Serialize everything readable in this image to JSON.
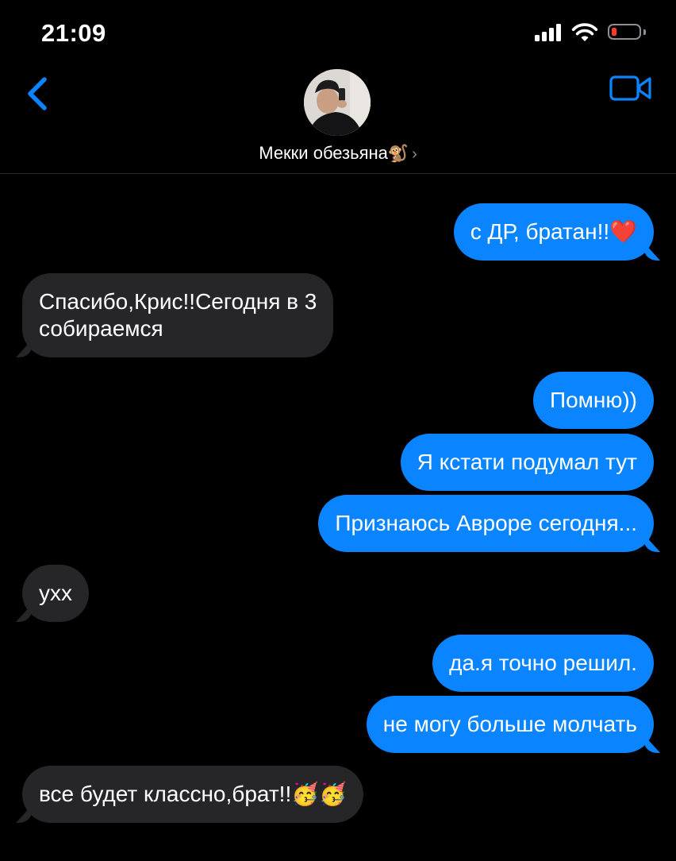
{
  "status_bar": {
    "time": "21:09",
    "battery_color": "#ff3b30"
  },
  "header": {
    "contact_name": "Мекки обезьяна",
    "contact_emoji": "🐒",
    "chevron": "›",
    "icons": [
      "back-chevron-icon",
      "contact-avatar",
      "video-camera-icon"
    ],
    "accent_color": "#0a84ff"
  },
  "messages": [
    {
      "from": "me",
      "text": "с ДР, братан!!",
      "emoji": "❤️"
    },
    {
      "from": "contact",
      "text_line1": "Спасибо,Крис!!Сегодня в 3",
      "text_line2": "собираемся"
    },
    {
      "from": "me",
      "text": "Помню))"
    },
    {
      "from": "me",
      "text": "Я кстати подумал тут"
    },
    {
      "from": "me",
      "text": "Признаюсь Авроре сегодня..."
    },
    {
      "from": "contact",
      "text": "ухх"
    },
    {
      "from": "me",
      "text": "да.я точно решил."
    },
    {
      "from": "me",
      "text": "не могу больше молчать"
    },
    {
      "from": "contact",
      "text": "все будет классно,брат!!",
      "emoji": "🥳🥳"
    }
  ],
  "colors": {
    "sent_bubble": "#0a84ff",
    "received_bubble": "#262628",
    "background": "#000000"
  }
}
